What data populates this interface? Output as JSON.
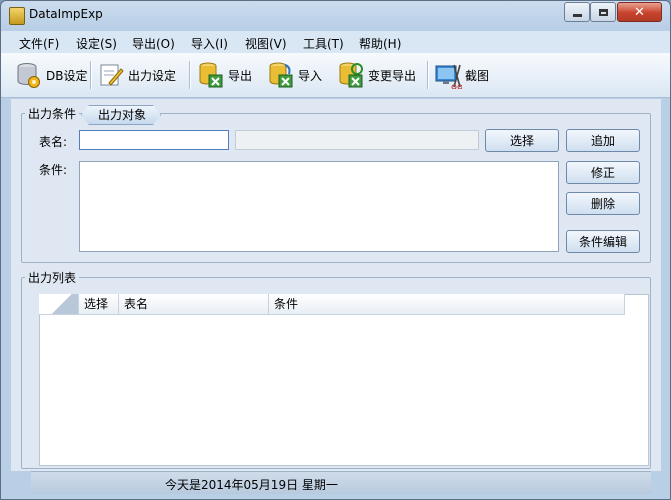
{
  "window": {
    "title": "DataImpExp",
    "close_glyph": "✕"
  },
  "menu": [
    "文件(F)",
    "设定(S)",
    "导出(O)",
    "导入(I)",
    "视图(V)",
    "工具(T)",
    "帮助(H)"
  ],
  "toolbar": {
    "db_settings": "DB设定",
    "output_settings": "出力设定",
    "export": "导出",
    "import": "导入",
    "change_export": "变更导出",
    "screenshot": "截图"
  },
  "conditions": {
    "group_title": "出力条件",
    "tab_label": "出力对象",
    "table_name_label": "表名:",
    "table_name_value": "",
    "condition_label": "条件:",
    "condition_value": "",
    "select_button": "选择",
    "add_button": "追加",
    "modify_button": "修正",
    "delete_button": "删除",
    "edit_condition_button": "条件编辑"
  },
  "output_list": {
    "group_title": "出力列表",
    "columns": [
      "选择",
      "表名",
      "条件"
    ],
    "rows": []
  },
  "status": {
    "text": "今天是2014年05月19日   星期一"
  }
}
